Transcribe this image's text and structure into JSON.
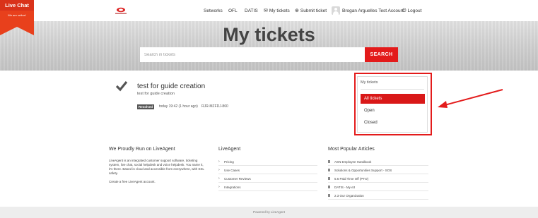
{
  "live_chat": {
    "title": "Live Chat",
    "subtitle": "We are online!"
  },
  "nav": {
    "networks": "Setworks",
    "ofl": "OFL",
    "datis": "DATIS",
    "my_tickets": "My tickets",
    "submit_ticket": "Submit ticket",
    "account": "Brogan Arguelles Test Account",
    "logout": "Logout"
  },
  "hero": {
    "title": "My tickets",
    "search_placeholder": "Search in tickets",
    "search_button": "SEARCH"
  },
  "ticket": {
    "title": "test for guide creation",
    "description": "test for guide creation",
    "status": "Resolved",
    "time": "today 19:42 (1 hour ago)",
    "code": "RJR-MZFDJ-860"
  },
  "sidebar": {
    "title": "My tickets",
    "items": [
      "All tickets",
      "Open",
      "Closed"
    ],
    "active_item": "All tickets"
  },
  "footer": {
    "col1_title": "We Proudly Run on LiveAgent",
    "col1_text": "LiveAgent is an integrated customer support software, ticketing system, live chat, social helpdesk and voice helpdesk. You name it, it's there. Based in cloud and accessible from everywhere, with SSL safety.",
    "col1_link": "Create a free LiveAgent account.",
    "col2_title": "LiveAgent",
    "col2_items": [
      "Pricing",
      "Use Cases",
      "Customer Reviews",
      "Integrations"
    ],
    "col3_title": "Most Popular Articles",
    "col3_items": [
      "ASN Employee Handbook",
      "Solutions & Opportunities Support - SOS",
      "5.6 Paid Time Off (PTO)",
      "DATIS - My e3",
      "2.3 Our Organization"
    ],
    "powered_by": "Powered by LiveAgent"
  },
  "colors": {
    "accent": "#e31b1b",
    "hero": "#cfcfcf"
  }
}
